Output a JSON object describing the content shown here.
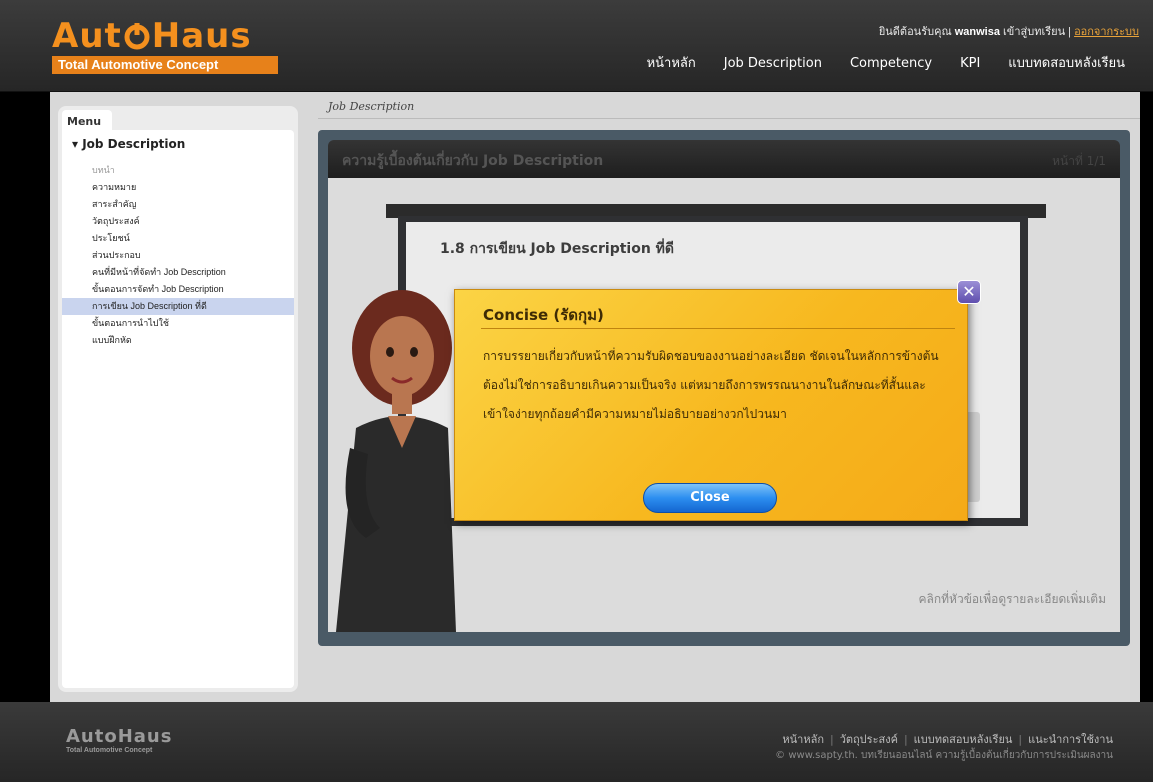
{
  "brand": {
    "logo_text": "AutoHaus",
    "tagline": "Total Automotive Concept",
    "accent": "#f4901e"
  },
  "header": {
    "welcome_prefix": "ยินดีต้อนรับคุณ",
    "username": "wanwisa",
    "welcome_suffix": "เข้าสู่บทเรียน |",
    "logout": "ออกจากระบบ",
    "nav": [
      "หน้าหลัก",
      "Job Description",
      "Competency",
      "KPI",
      "แบบทดสอบหลังเรียน"
    ]
  },
  "sidebar": {
    "tab": "Menu",
    "section": "Job Description",
    "items": [
      "บทนำ",
      "ความหมาย",
      "สาระสำคัญ",
      "วัตถุประสงค์",
      "ประโยชน์",
      "ส่วนประกอบ",
      "คนที่มีหน้าที่จัดทำ Job Description",
      "ขั้นตอนการจัดทำ Job Description",
      "การเขียน Job Description ที่ดี",
      "ขั้นตอนการนำไปใช้",
      "แบบฝึกหัด"
    ],
    "active_index": 8
  },
  "content": {
    "breadcrumb": "Job Description",
    "slide_title": "ความรู้เบื้องต้นเกี่ยวกับ Job Description",
    "slide_page": "หน้าที่ 1/1",
    "board_heading": "1.8 การเขียน Job Description ที่ดี",
    "note": "คลิกที่หัวข้อเพื่อดูรายละเอียดเพิ่มเติม"
  },
  "modal": {
    "title": "Concise (รัดกุม)",
    "body": "การบรรยายเกี่ยวกับหน้าที่ความรับผิดชอบของงานอย่างละเอียด ชัดเจนในหลักการข้างต้น ต้องไม่ใช่การอธิบายเกินความเป็นจริง แต่หมายถึงการพรรณนางานในลักษณะที่สั้นและเข้าใจง่ายทุกถ้อยคำมีความหมายไม่อธิบายอย่างวกไปวนมา",
    "close_label": "Close",
    "close_icon": "close-x-icon"
  },
  "footer": {
    "logo_text": "AutoHaus",
    "tagline": "Total Automotive Concept",
    "links": [
      "หน้าหลัก",
      "วัตถุประสงค์",
      "แบบทดสอบหลังเรียน",
      "แนะนำการใช้งาน"
    ],
    "copyright": "© www.sapty.th. บทเรียนออนไลน์ ความรู้เบื้องต้นเกี่ยวกับการประเมินผลงาน"
  }
}
